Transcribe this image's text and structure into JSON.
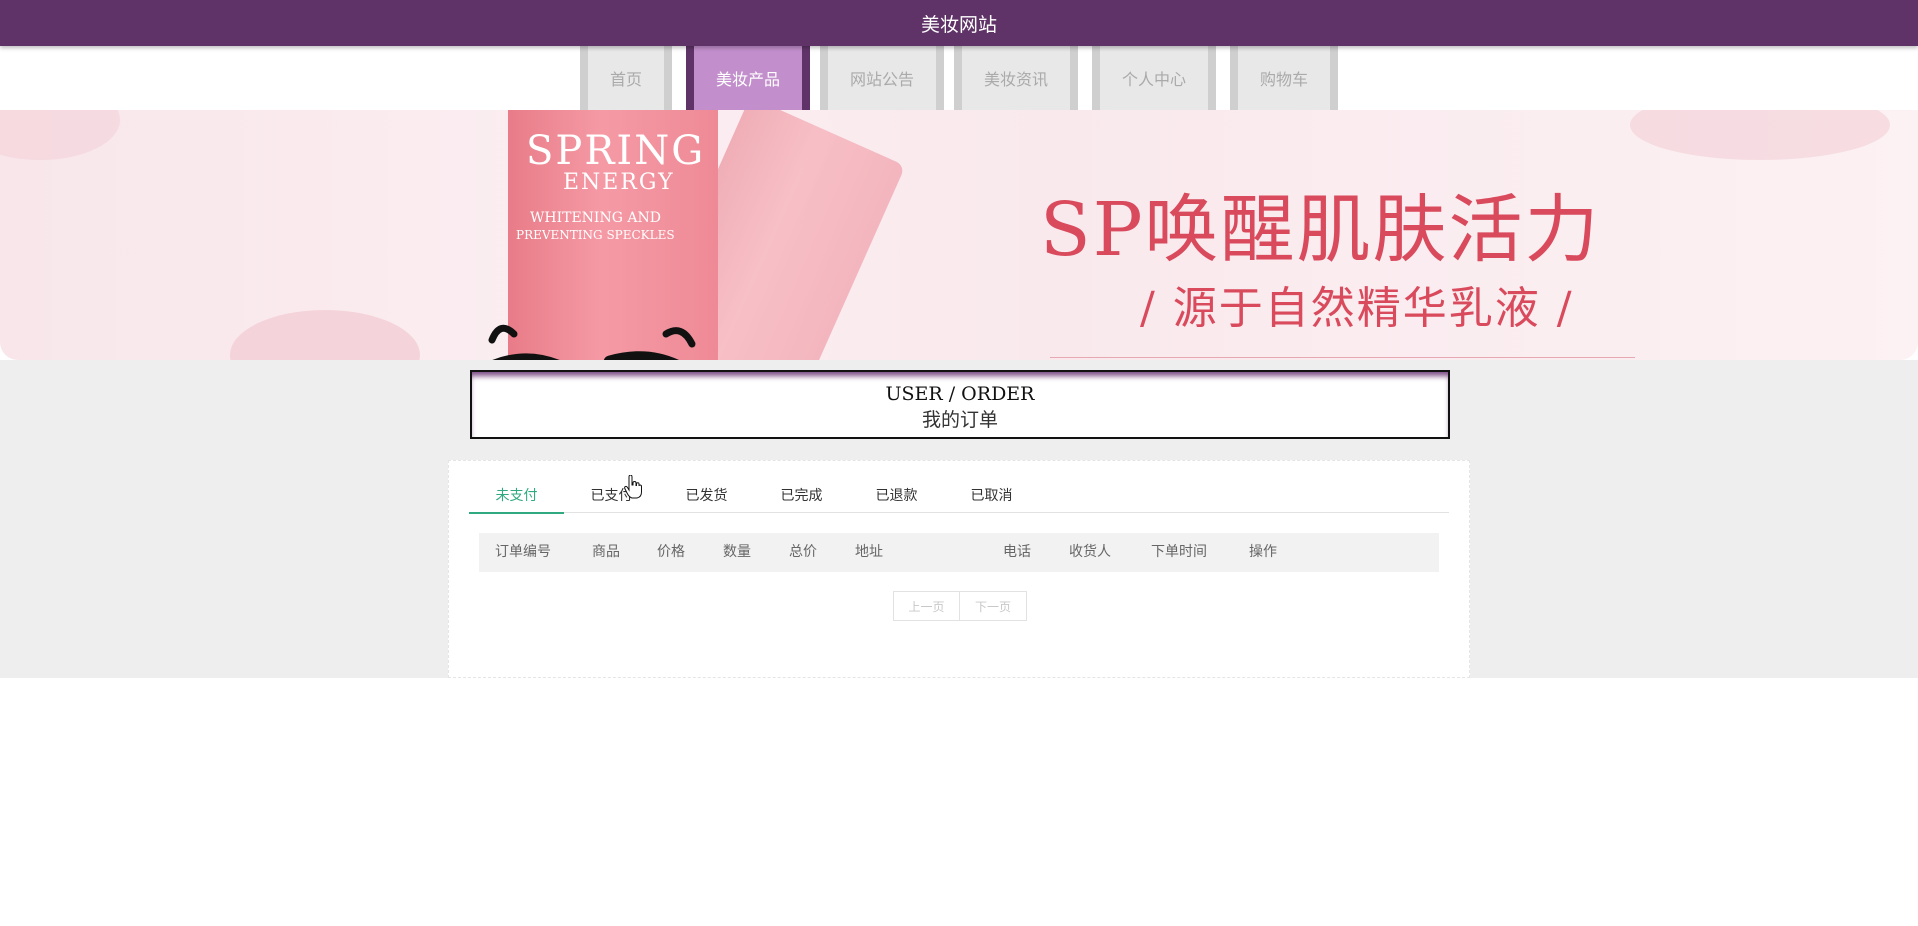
{
  "site": {
    "title": "美妆网站"
  },
  "nav": {
    "items": [
      {
        "label": "首页",
        "active": false
      },
      {
        "label": "美妆产品",
        "active": true
      },
      {
        "label": "网站公告",
        "active": false
      },
      {
        "label": "美妆资讯",
        "active": false
      },
      {
        "label": "个人中心",
        "active": false
      },
      {
        "label": "购物车",
        "active": false
      }
    ]
  },
  "banner": {
    "tube_brand": "SPRING",
    "tube_sub": "ENERGY",
    "tube_line1": "WHITENING AND",
    "tube_line2": "PREVENTING SPECKLES",
    "headline": "SP唤醒肌肤活力",
    "subline": "/ 源于自然精华乳液 /"
  },
  "section": {
    "title_en": "USER / ORDER",
    "title_cn": "我的订单"
  },
  "order_tabs": [
    {
      "label": "未支付",
      "active": true
    },
    {
      "label": "已支付",
      "active": false
    },
    {
      "label": "已发货",
      "active": false
    },
    {
      "label": "已完成",
      "active": false
    },
    {
      "label": "已退款",
      "active": false
    },
    {
      "label": "已取消",
      "active": false
    }
  ],
  "table": {
    "columns": [
      "订单编号",
      "商品",
      "价格",
      "数量",
      "总价",
      "地址",
      "电话",
      "收货人",
      "下单时间",
      "操作"
    ]
  },
  "pager": {
    "prev": "上一页",
    "next": "下一页"
  },
  "colors": {
    "header": "#5f3367",
    "nav_active": "#c28fcc",
    "tab_active": "#2fa97f",
    "banner_text": "#d94a5c"
  }
}
